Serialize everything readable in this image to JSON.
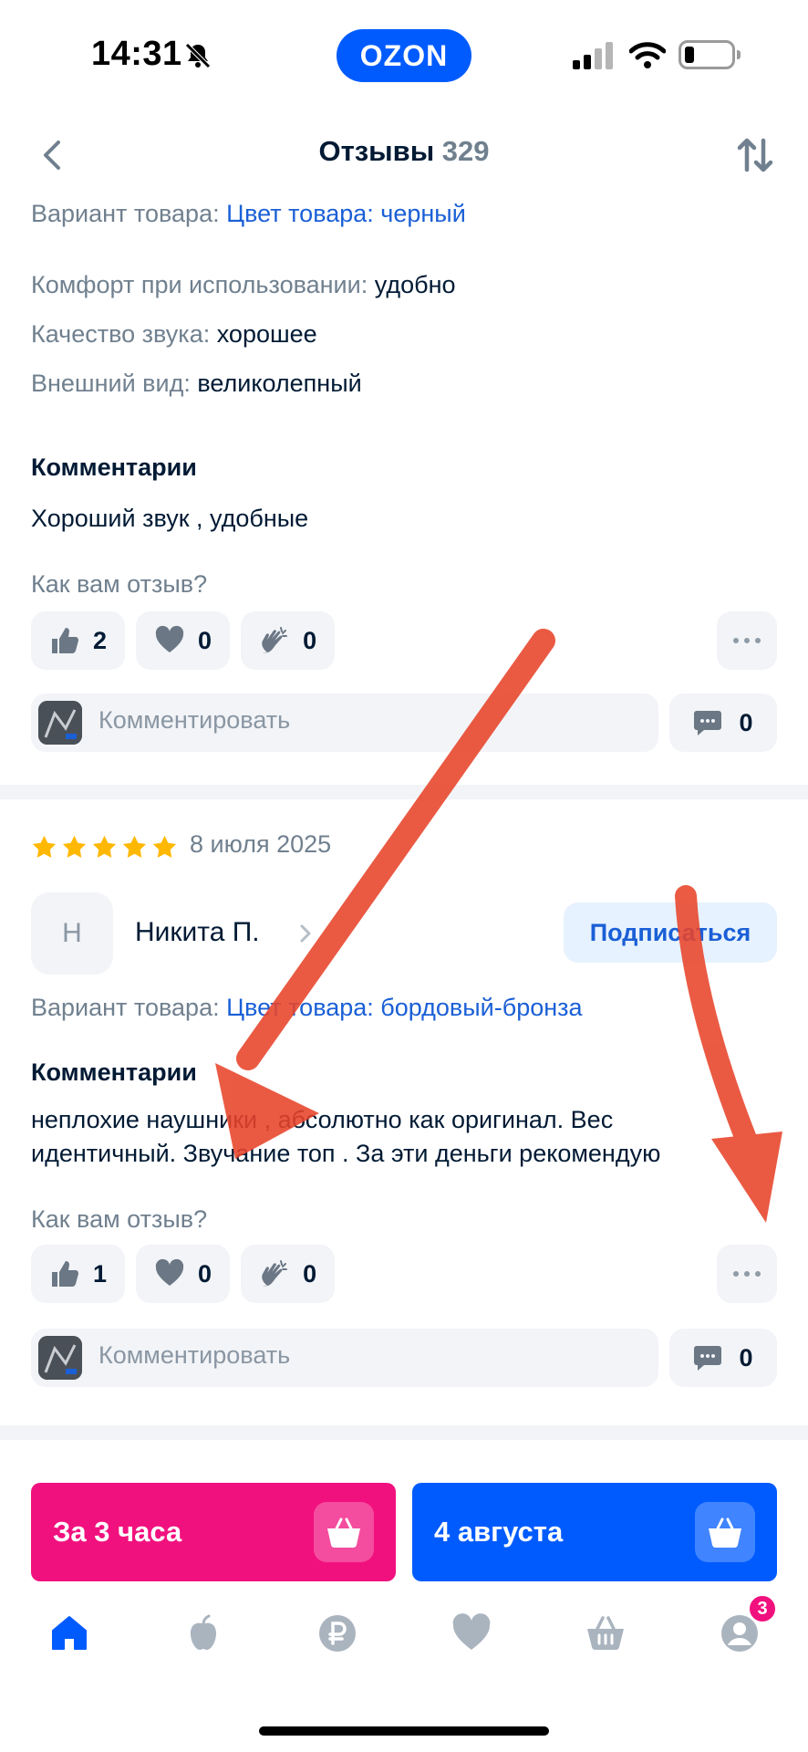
{
  "status_bar": {
    "time": "14:31",
    "brand": "OZON"
  },
  "header": {
    "title": "Отзывы",
    "count": "329"
  },
  "review1": {
    "variant_label": "Вариант товара:",
    "variant_value": "Цвет товара: черный",
    "attributes": [
      {
        "label": "Комфорт при использовании:",
        "value": "удобно"
      },
      {
        "label": "Качество звука:",
        "value": "хорошее"
      },
      {
        "label": "Внешний вид:",
        "value": "великолепный"
      }
    ],
    "comments_title": "Комментарии",
    "comment": "Хороший звук , удобные",
    "question": "Как вам отзыв?",
    "reactions": {
      "likes": "2",
      "hearts": "0",
      "claps": "0"
    },
    "comment_placeholder": "Комментировать",
    "comments_count": "0"
  },
  "review2": {
    "rating": 5,
    "date": "8 июля 2025",
    "avatar_letter": "Н",
    "author": "Никита П.",
    "subscribe": "Подписаться",
    "variant_label": "Вариант товара:",
    "variant_value": "Цвет товара: бордовый-бронза",
    "comments_title": "Комментарии",
    "comment_line1": "неплохие наушники , абсолютно как  оригинал. Вес",
    "comment_line2": "идентичный. Звучание топ . За эти деньги рекомендую",
    "question": "Как вам отзыв?",
    "reactions": {
      "likes": "1",
      "hearts": "0",
      "claps": "0"
    },
    "comment_placeholder": "Комментировать",
    "comments_count": "0"
  },
  "buy_bar": {
    "fast_label": "За 3 часа",
    "date_label": "4 августа"
  },
  "nav": {
    "profile_badge": "3"
  },
  "colors": {
    "brand_blue": "#005bff",
    "accent_pink": "#f1117e",
    "link": "#1a5fd6",
    "star": "#ffb800",
    "annotation": "#e8442a"
  }
}
